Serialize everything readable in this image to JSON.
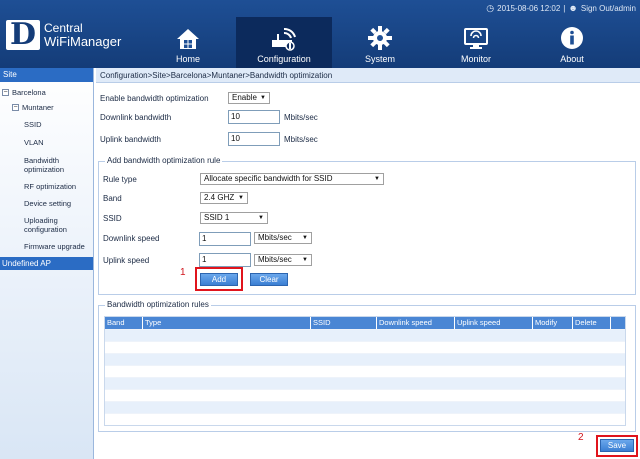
{
  "topbar": {
    "datetime": "2015-08-06 12:02",
    "separator": "|",
    "signout": "Sign Out/admin"
  },
  "logo": {
    "letter": "D",
    "line1": "Central",
    "line2": "WiFiManager"
  },
  "nav": [
    {
      "label": "Home",
      "icon": "home-icon"
    },
    {
      "label": "Configuration",
      "icon": "router-icon",
      "active": true
    },
    {
      "label": "System",
      "icon": "gear-icon"
    },
    {
      "label": "Monitor",
      "icon": "monitor-icon"
    },
    {
      "label": "About",
      "icon": "info-icon"
    }
  ],
  "sidebar": {
    "site_label": "Site",
    "tree_collapse": "−",
    "barcelona": "Barcelona",
    "muntaner": "Muntaner",
    "items": [
      "SSID",
      "VLAN",
      "Bandwidth optimization",
      "RF optimization",
      "Device setting",
      "Uploading configuration",
      "Firmware upgrade"
    ],
    "undefined_ap": "Undefined AP"
  },
  "breadcrumb": "Configuration>Site>Barcelona>Muntaner>Bandwidth optimization",
  "form": {
    "enable_label": "Enable bandwidth optimization",
    "enable_value": "Enable",
    "downlink_label": "Downlink bandwidth",
    "downlink_value": "10",
    "uplink_label": "Uplink bandwidth",
    "uplink_value": "10",
    "unit": "Mbits/sec"
  },
  "rule": {
    "legend": "Add bandwidth optimization rule",
    "rule_type_label": "Rule type",
    "rule_type_value": "Allocate specific bandwidth for SSID",
    "band_label": "Band",
    "band_value": "2.4 GHZ",
    "ssid_label": "SSID",
    "ssid_value": "SSID 1",
    "downlink_speed_label": "Downlink speed",
    "downlink_speed_value": "1",
    "uplink_speed_label": "Uplink speed",
    "uplink_speed_value": "1",
    "unit": "Mbits/sec",
    "add_label": "Add",
    "clear_label": "Clear"
  },
  "rules_table": {
    "legend": "Bandwidth optimization rules",
    "columns": [
      "Band",
      "Type",
      "SSID",
      "Downlink speed",
      "Uplink speed",
      "Modify",
      "Delete"
    ]
  },
  "save_label": "Save",
  "markers": {
    "one": "1",
    "two": "2"
  },
  "colors": {
    "header": "#1e4f95",
    "accent": "#2b6cc4",
    "highlight": "#e0141c"
  }
}
